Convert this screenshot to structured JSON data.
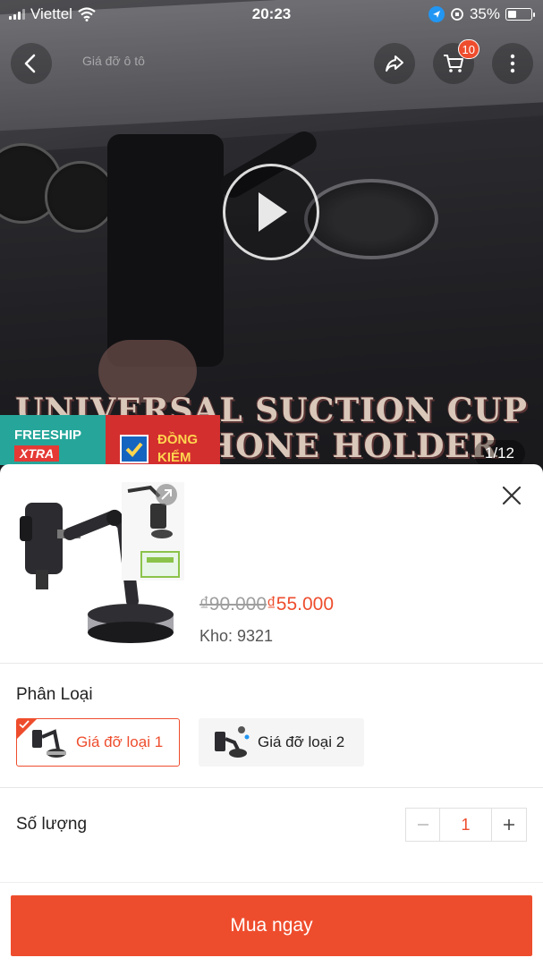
{
  "status_bar": {
    "carrier": "Viettel",
    "time": "20:23",
    "battery": "35%"
  },
  "hero": {
    "faint_title": "Giá đỡ ô tô",
    "cart_count": "10",
    "overlay_line1": "UNIVERSAL SUCTION CUP",
    "overlay_line2": "PHONE HOLDER",
    "page_counter": "1/12",
    "badge_freeship_line1": "FREESHIP",
    "badge_freeship_line2": "XTRA",
    "badge_dongkiem_line1": "ĐỒNG",
    "badge_dongkiem_line2": "KIỂM"
  },
  "sheet": {
    "price_original": "₫90.000",
    "price_sale": "₫55.000",
    "stock": "Kho: 9321",
    "variation_label": "Phân Loại",
    "variants": [
      {
        "label": "Giá đỡ loại 1",
        "selected": true
      },
      {
        "label": "Giá đỡ loại 2",
        "selected": false
      }
    ],
    "quantity_label": "Số lượng",
    "quantity": "1",
    "buy_button": "Mua ngay"
  },
  "colors": {
    "accent": "#ee4d2d",
    "freeship": "#26a69a",
    "dongkiem": "#d32f2f"
  }
}
